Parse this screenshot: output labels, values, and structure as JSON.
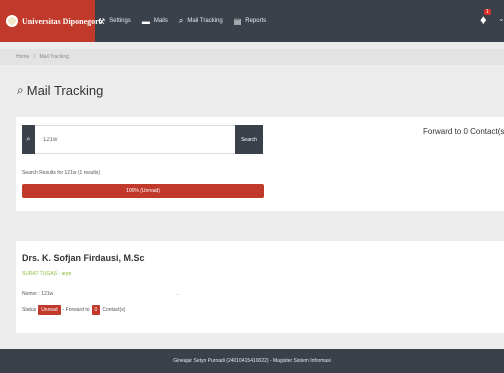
{
  "brand": {
    "name": "Universitas Diponegoro"
  },
  "nav": {
    "items": [
      {
        "label": "Settings",
        "icon": "⚒"
      },
      {
        "label": "Mails",
        "icon": "▬"
      },
      {
        "label": "Mail Tracking",
        "icon": "⌕"
      },
      {
        "label": "Reports",
        "icon": "▤"
      }
    ]
  },
  "notifications": {
    "count": "1",
    "icon": "♦",
    "caret": "⌄"
  },
  "breadcrumb": {
    "home": "Home",
    "separator": "/",
    "current": "Mail Tracking"
  },
  "page": {
    "title": "Mail Tracking",
    "title_icon": "⌕"
  },
  "search": {
    "value": "121w",
    "button_label": "Search",
    "icon": "⌕",
    "results_text": "Search Results for 121w (1 results)",
    "progress_label": "100% (Unread)",
    "progress_fraction": 1.0,
    "forward_text": "Forward to 0 Contact(s)"
  },
  "result": {
    "name": "Drs. K. Sofjan Firdausi, M.Sc",
    "tag": "SURAT TUGAS - arpe",
    "nomor_label": "Nomor",
    "nomor_value": ": 121w",
    "nomor_dots": "...",
    "status_label": "Status",
    "status_value": "Unread",
    "forward_prefix": "- Forward to",
    "forward_count": "0",
    "forward_suffix": "Contact(s)"
  },
  "footer": {
    "text": "Gineajar Setyo Purnadi (24010415410022) - Magister Sistem Informasi"
  },
  "colors": {
    "accent": "#c0392b",
    "dark": "#3b414b",
    "tag_green": "#8cbf3f"
  }
}
